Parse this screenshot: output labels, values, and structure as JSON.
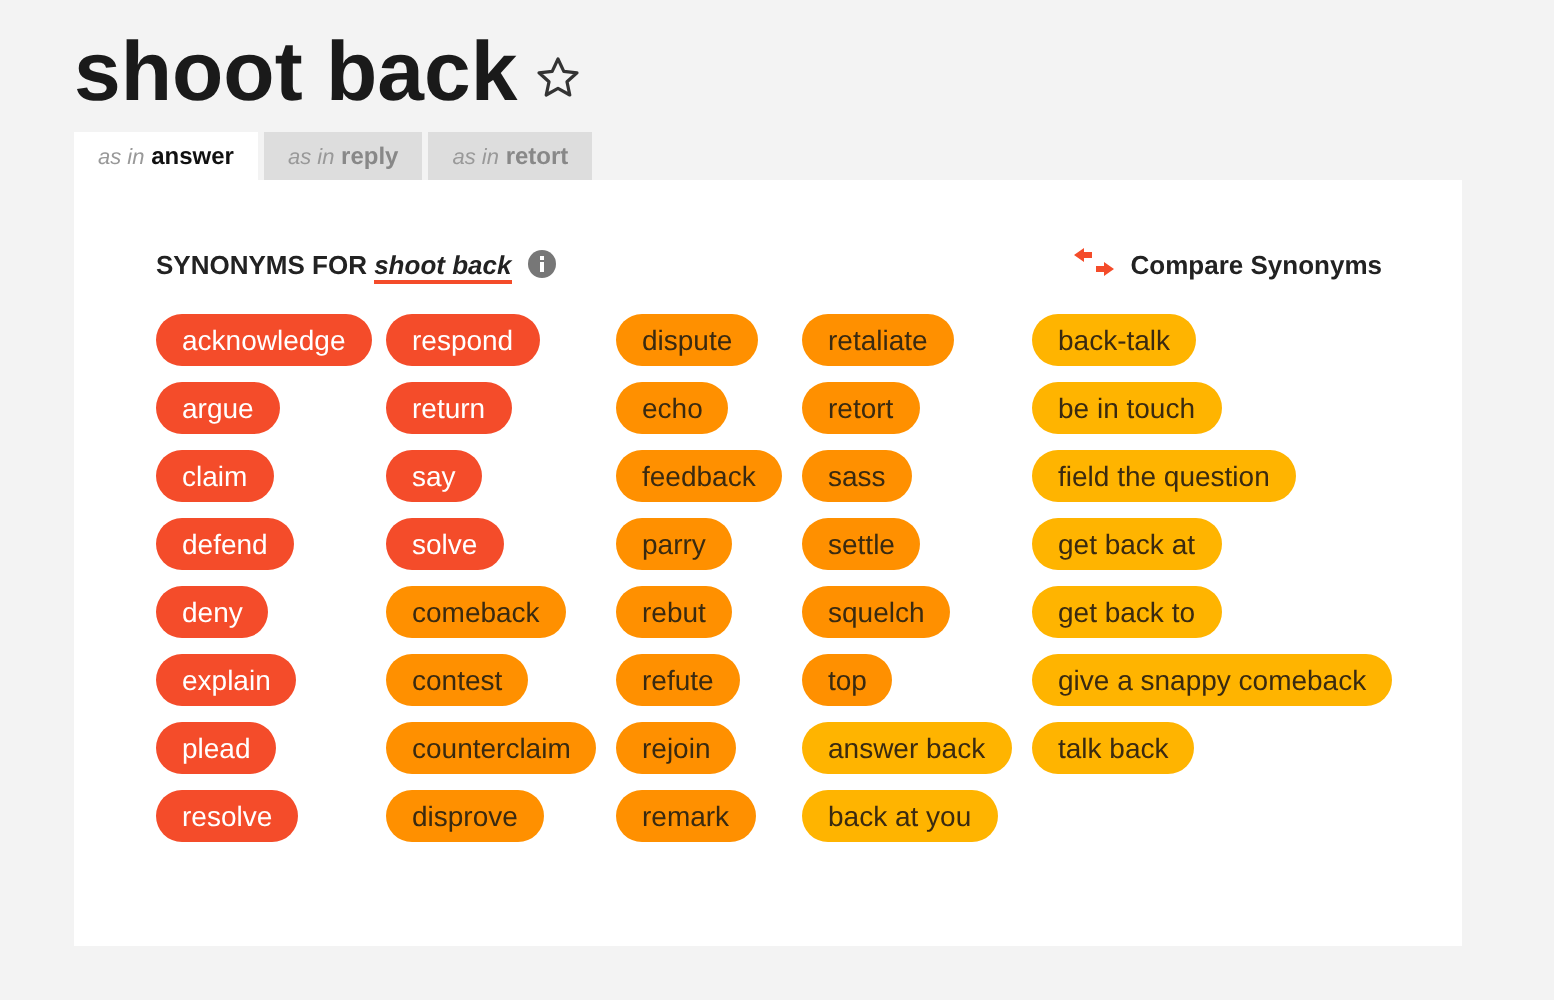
{
  "title": "shoot back",
  "tabs": [
    {
      "prefix": "as in",
      "label": "answer",
      "selected": true
    },
    {
      "prefix": "as in",
      "label": "reply",
      "selected": false
    },
    {
      "prefix": "as in",
      "label": "retort",
      "selected": false
    }
  ],
  "heading": {
    "label": "SYNONYMS FOR",
    "word": "shoot back"
  },
  "compare": "Compare Synonyms",
  "columns": [
    [
      {
        "text": "acknowledge",
        "kind": "strongest"
      },
      {
        "text": "argue",
        "kind": "strongest"
      },
      {
        "text": "claim",
        "kind": "strongest"
      },
      {
        "text": "defend",
        "kind": "strongest"
      },
      {
        "text": "deny",
        "kind": "strongest"
      },
      {
        "text": "explain",
        "kind": "strongest"
      },
      {
        "text": "plead",
        "kind": "strongest"
      },
      {
        "text": "resolve",
        "kind": "strongest"
      }
    ],
    [
      {
        "text": "respond",
        "kind": "strongest"
      },
      {
        "text": "return",
        "kind": "strongest"
      },
      {
        "text": "say",
        "kind": "strongest"
      },
      {
        "text": "solve",
        "kind": "strongest"
      },
      {
        "text": "comeback",
        "kind": "strong"
      },
      {
        "text": "contest",
        "kind": "strong"
      },
      {
        "text": "counterclaim",
        "kind": "strong"
      },
      {
        "text": "disprove",
        "kind": "strong"
      }
    ],
    [
      {
        "text": "dispute",
        "kind": "strong"
      },
      {
        "text": "echo",
        "kind": "strong"
      },
      {
        "text": "feedback",
        "kind": "strong"
      },
      {
        "text": "parry",
        "kind": "strong"
      },
      {
        "text": "rebut",
        "kind": "strong"
      },
      {
        "text": "refute",
        "kind": "strong"
      },
      {
        "text": "rejoin",
        "kind": "strong"
      },
      {
        "text": "remark",
        "kind": "strong"
      }
    ],
    [
      {
        "text": "retaliate",
        "kind": "strong"
      },
      {
        "text": "retort",
        "kind": "strong"
      },
      {
        "text": "sass",
        "kind": "strong"
      },
      {
        "text": "settle",
        "kind": "strong"
      },
      {
        "text": "squelch",
        "kind": "strong"
      },
      {
        "text": "top",
        "kind": "strong"
      },
      {
        "text": "answer back",
        "kind": "weak"
      },
      {
        "text": "back at you",
        "kind": "weak"
      }
    ],
    [
      {
        "text": "back-talk",
        "kind": "weak"
      },
      {
        "text": "be in touch",
        "kind": "weak"
      },
      {
        "text": "field the question",
        "kind": "weak"
      },
      {
        "text": "get back at",
        "kind": "weak"
      },
      {
        "text": "get back to",
        "kind": "weak"
      },
      {
        "text": "give a snappy comeback",
        "kind": "weak"
      },
      {
        "text": "talk back",
        "kind": "weak"
      }
    ]
  ]
}
